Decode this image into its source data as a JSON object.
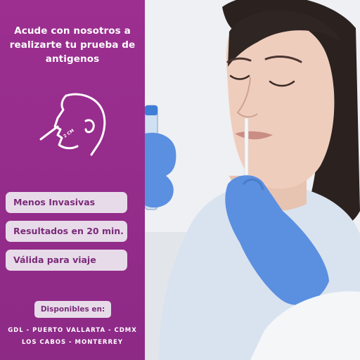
{
  "panel": {
    "headline": "Acude con nosotros a realizarte tu prueba de antigenos",
    "icon": "nose-swab-icon",
    "icon_label": "2 CM",
    "benefits": [
      "Menos Invasivas",
      "Resultados en 20 min.",
      "Válida para viaje"
    ],
    "available_label": "Disponibles en:",
    "cities_line1": "GDL - PUERTO VALLARTA - CDMX",
    "cities_line2": "LOS CABOS - MONTERREY"
  },
  "colors": {
    "panel_purple": "#9c2f90",
    "pill_background": "#e7dbe9",
    "pill_text": "#7b2a79",
    "glove_blue": "#5b8fe0"
  },
  "photo": {
    "subject": "woman-receiving-nasal-swab-photo"
  }
}
